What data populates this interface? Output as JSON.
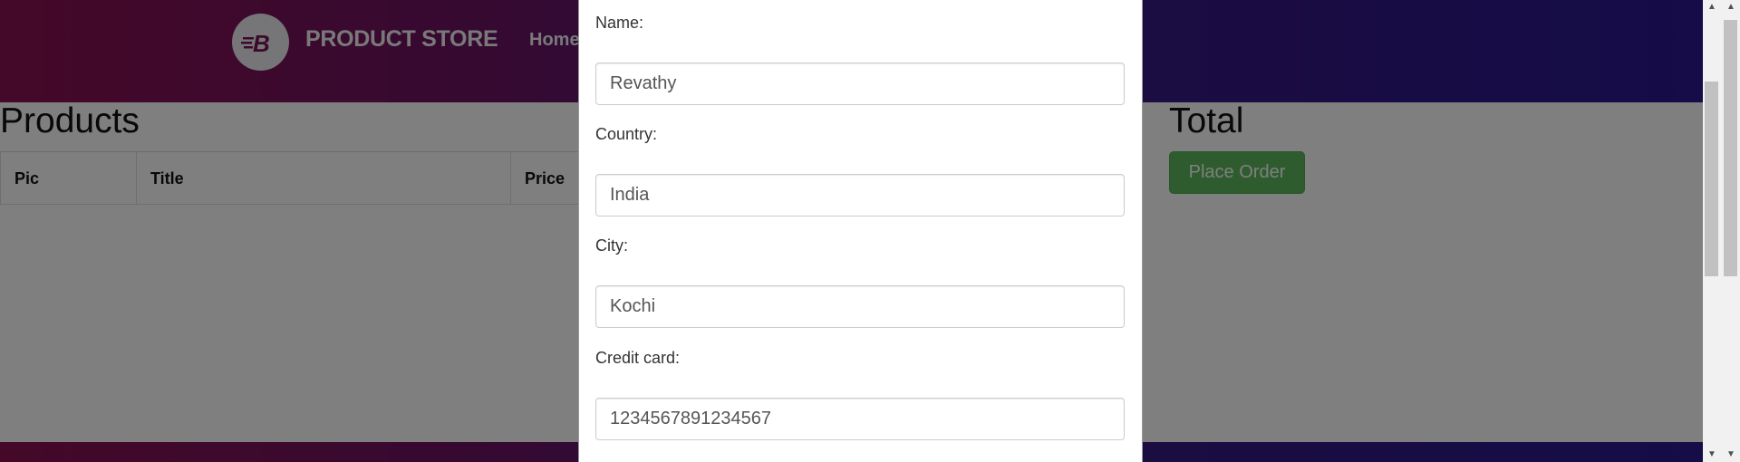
{
  "navbar": {
    "brand": "PRODUCT STORE",
    "logo_letter": "B",
    "home_label": "Home"
  },
  "cart": {
    "products_title": "Products",
    "columns": [
      "Pic",
      "Title",
      "Price"
    ],
    "total_title": "Total",
    "place_order_label": "Place Order"
  },
  "order_form": {
    "name_label": "Name:",
    "name_value": "Revathy",
    "country_label": "Country:",
    "country_value": "India",
    "city_label": "City:",
    "city_value": "Kochi",
    "card_label": "Credit card:",
    "card_value": "1234567891234567"
  },
  "colors": {
    "navbar_left": "#8a1151",
    "navbar_right": "#2a1890",
    "place_order": "#5cb85c"
  },
  "icons": {
    "scroll_up": "triangle-up",
    "scroll_down": "triangle-down"
  }
}
